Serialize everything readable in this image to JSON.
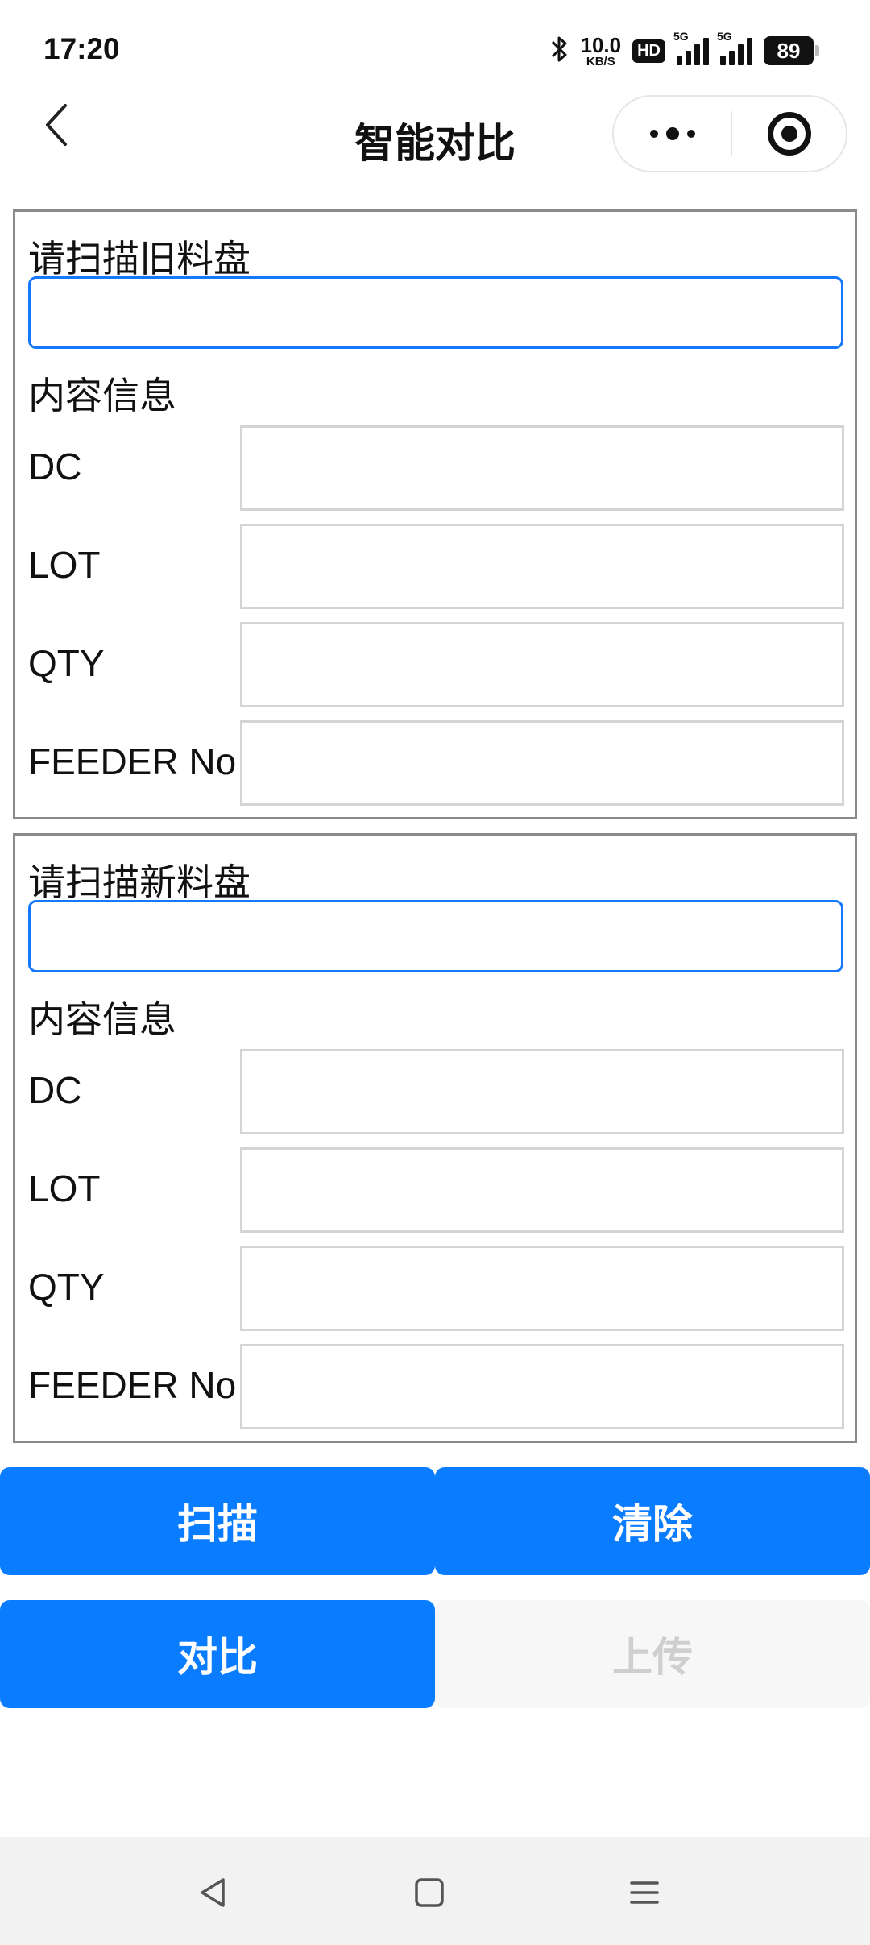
{
  "status_bar": {
    "time": "17:20",
    "speed_value": "10.0",
    "speed_unit": "KB/S",
    "hd_badge": "HD",
    "signal_tag_1": "5G",
    "signal_tag_2": "5G",
    "battery": "89",
    "icons": [
      "bluetooth-icon",
      "signal-icon",
      "battery-icon"
    ]
  },
  "nav": {
    "title": "智能对比",
    "icons": [
      "chevron-left-icon",
      "more-dots-icon",
      "target-icon"
    ]
  },
  "old_reel": {
    "scan_label": "请扫描旧料盘",
    "scan_value": "",
    "info_label": "内容信息",
    "fields": [
      {
        "label": "DC",
        "value": ""
      },
      {
        "label": "LOT",
        "value": ""
      },
      {
        "label": "QTY",
        "value": ""
      },
      {
        "label": "FEEDER No",
        "value": ""
      }
    ]
  },
  "new_reel": {
    "scan_label": "请扫描新料盘",
    "scan_value": "",
    "info_label": "内容信息",
    "fields": [
      {
        "label": "DC",
        "value": ""
      },
      {
        "label": "LOT",
        "value": ""
      },
      {
        "label": "QTY",
        "value": ""
      },
      {
        "label": "FEEDER No",
        "value": ""
      }
    ]
  },
  "actions": {
    "scan": "扫描",
    "clear": "清除",
    "compare": "对比",
    "upload": "上传"
  },
  "colors": {
    "primary": "#0a7cff",
    "disabled_bg": "#f7f7f7",
    "disabled_text": "#cfcfcf",
    "section_border": "#8a8a8a",
    "input_focus_border": "#1677ff"
  }
}
